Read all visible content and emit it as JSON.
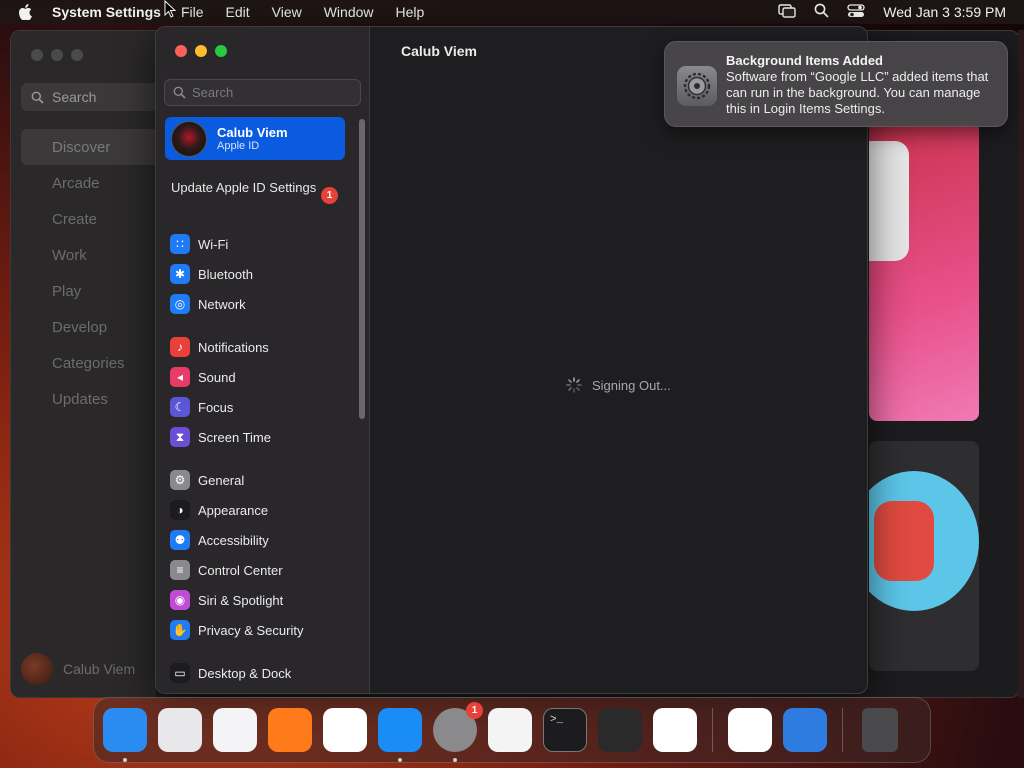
{
  "menubar": {
    "app_name": "System Settings",
    "items": [
      "File",
      "Edit",
      "View",
      "Window",
      "Help"
    ],
    "clock": "Wed Jan 3  3:59 PM"
  },
  "app_store": {
    "search_label": "Search",
    "nav": [
      "Discover",
      "Arcade",
      "Create",
      "Work",
      "Play",
      "Develop",
      "Categories",
      "Updates"
    ],
    "active_nav": "Discover",
    "user_name": "Calub Viem"
  },
  "settings": {
    "search_placeholder": "Search",
    "account": {
      "name": "Calub Viem",
      "subtitle": "Apple ID"
    },
    "update_label": "Update Apple ID Settings",
    "update_badge": "1",
    "groups": [
      [
        {
          "label": "Wi-Fi",
          "icon": "wifi-icon",
          "color": "#1f7cf6"
        },
        {
          "label": "Bluetooth",
          "icon": "bluetooth-icon",
          "color": "#1f7cf6"
        },
        {
          "label": "Network",
          "icon": "globe-icon",
          "color": "#1f7cf6"
        }
      ],
      [
        {
          "label": "Notifications",
          "icon": "bell-icon",
          "color": "#e8413a"
        },
        {
          "label": "Sound",
          "icon": "speaker-icon",
          "color": "#e83c68"
        },
        {
          "label": "Focus",
          "icon": "moon-icon",
          "color": "#5b56d6"
        },
        {
          "label": "Screen Time",
          "icon": "hourglass-icon",
          "color": "#6a4fd6"
        }
      ],
      [
        {
          "label": "General",
          "icon": "gear-icon",
          "color": "#8a8a8e"
        },
        {
          "label": "Appearance",
          "icon": "appearance-icon",
          "color": "#1c1c1e"
        },
        {
          "label": "Accessibility",
          "icon": "accessibility-icon",
          "color": "#1f7cf6"
        },
        {
          "label": "Control Center",
          "icon": "control-center-icon",
          "color": "#8a8a8e"
        },
        {
          "label": "Siri & Spotlight",
          "icon": "siri-icon",
          "color": "#c04bd6"
        },
        {
          "label": "Privacy & Security",
          "icon": "hand-icon",
          "color": "#1f7cf6"
        }
      ],
      [
        {
          "label": "Desktop & Dock",
          "icon": "desktop-icon",
          "color": "#1c1c1e"
        }
      ]
    ],
    "content_title": "Calub Viem",
    "status_text": "Signing Out..."
  },
  "notification": {
    "title": "Background Items Added",
    "body": "Software from “Google LLC” added items that can run in the background. You can manage this in Login Items Settings."
  },
  "dock": {
    "items": [
      {
        "name": "finder-icon",
        "color": "#2a8cf0",
        "running": true
      },
      {
        "name": "launchpad-icon",
        "color": "#e8e8ea",
        "running": false
      },
      {
        "name": "safari-icon",
        "color": "#f4f4f6",
        "running": false
      },
      {
        "name": "firefox-icon",
        "color": "#ff7a1a",
        "running": false
      },
      {
        "name": "chrome-icon",
        "color": "#ffffff",
        "running": false
      },
      {
        "name": "app-store-icon",
        "color": "#1a8cf5",
        "running": true
      },
      {
        "name": "system-settings-icon",
        "color": "#8a8a8c",
        "running": true,
        "badge": "1"
      },
      {
        "name": "textedit-icon",
        "color": "#f4f4f4",
        "running": false
      },
      {
        "name": "terminal-icon",
        "color": "#1c1c1e",
        "running": false
      },
      {
        "name": "garageband-icon",
        "color": "#2a2a2a",
        "running": false
      },
      {
        "name": "vscode-icon",
        "color": "#ffffff",
        "running": false
      },
      {
        "name": "visual-studio-icon",
        "color": "#ffffff",
        "running": false,
        "sep_before": true
      },
      {
        "name": "weather-icon",
        "color": "#2f7ce0",
        "running": false
      },
      {
        "name": "trash-icon",
        "color": "#4a4a4c",
        "running": false,
        "sep_before": true
      }
    ]
  }
}
